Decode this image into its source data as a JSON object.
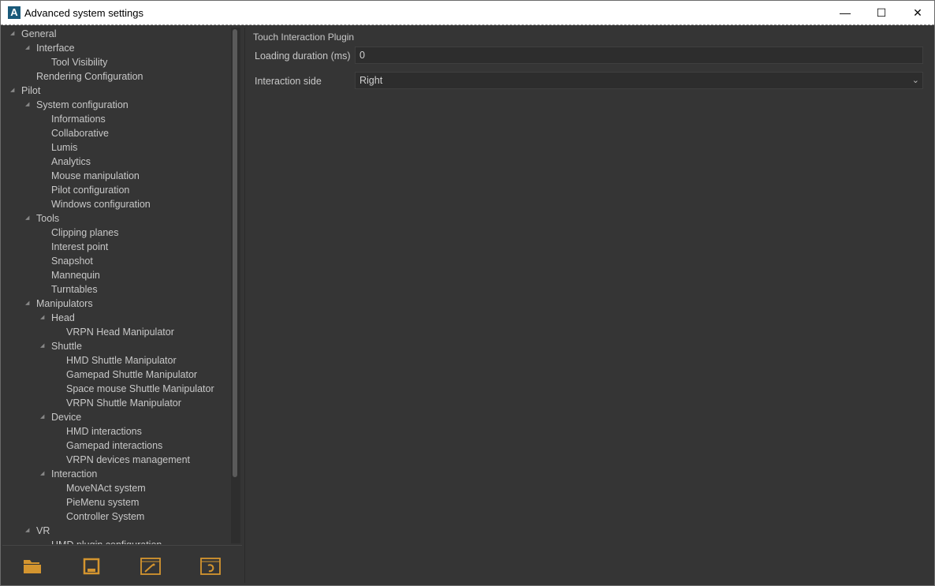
{
  "window": {
    "title": "Advanced system settings",
    "logo": "A",
    "minimize": "—",
    "maximize": "☐",
    "close": "✕"
  },
  "tree": [
    {
      "label": "General",
      "level": 0,
      "expandable": true
    },
    {
      "label": "Interface",
      "level": 1,
      "expandable": true
    },
    {
      "label": "Tool Visibility",
      "level": 2,
      "expandable": false
    },
    {
      "label": "Rendering Configuration",
      "level": 1,
      "expandable": false
    },
    {
      "label": "Pilot",
      "level": 0,
      "expandable": true
    },
    {
      "label": "System configuration",
      "level": 1,
      "expandable": true
    },
    {
      "label": "Informations",
      "level": 2,
      "expandable": false
    },
    {
      "label": "Collaborative",
      "level": 2,
      "expandable": false
    },
    {
      "label": "Lumis",
      "level": 2,
      "expandable": false
    },
    {
      "label": "Analytics",
      "level": 2,
      "expandable": false
    },
    {
      "label": "Mouse manipulation",
      "level": 2,
      "expandable": false
    },
    {
      "label": "Pilot configuration",
      "level": 2,
      "expandable": false
    },
    {
      "label": "Windows configuration",
      "level": 2,
      "expandable": false
    },
    {
      "label": "Tools",
      "level": 1,
      "expandable": true
    },
    {
      "label": "Clipping planes",
      "level": 2,
      "expandable": false
    },
    {
      "label": "Interest point",
      "level": 2,
      "expandable": false
    },
    {
      "label": "Snapshot",
      "level": 2,
      "expandable": false
    },
    {
      "label": "Mannequin",
      "level": 2,
      "expandable": false
    },
    {
      "label": "Turntables",
      "level": 2,
      "expandable": false
    },
    {
      "label": "Manipulators",
      "level": 1,
      "expandable": true
    },
    {
      "label": "Head",
      "level": 2,
      "expandable": true
    },
    {
      "label": "VRPN Head Manipulator",
      "level": 3,
      "expandable": false
    },
    {
      "label": "Shuttle",
      "level": 2,
      "expandable": true
    },
    {
      "label": "HMD Shuttle Manipulator",
      "level": 3,
      "expandable": false
    },
    {
      "label": "Gamepad Shuttle Manipulator",
      "level": 3,
      "expandable": false
    },
    {
      "label": "Space mouse Shuttle Manipulator",
      "level": 3,
      "expandable": false
    },
    {
      "label": "VRPN Shuttle Manipulator",
      "level": 3,
      "expandable": false
    },
    {
      "label": "Device",
      "level": 2,
      "expandable": true
    },
    {
      "label": "HMD interactions",
      "level": 3,
      "expandable": false
    },
    {
      "label": "Gamepad interactions",
      "level": 3,
      "expandable": false
    },
    {
      "label": "VRPN devices management",
      "level": 3,
      "expandable": false
    },
    {
      "label": "Interaction",
      "level": 2,
      "expandable": true
    },
    {
      "label": "MoveNAct system",
      "level": 3,
      "expandable": false
    },
    {
      "label": "PieMenu system",
      "level": 3,
      "expandable": false
    },
    {
      "label": "Controller System",
      "level": 3,
      "expandable": false
    },
    {
      "label": "VR",
      "level": 1,
      "expandable": true
    },
    {
      "label": "HMD plugin configuration",
      "level": 2,
      "expandable": false
    }
  ],
  "toolbar": {
    "icons": [
      "open-folder-icon",
      "save-icon",
      "wizard-icon",
      "reset-icon"
    ],
    "accent": "#d4952f"
  },
  "panel": {
    "group_title": "Touch Interaction Plugin",
    "loading_label": "Loading duration (ms)",
    "loading_value": "0",
    "side_label": "Interaction side",
    "side_value": "Right"
  }
}
